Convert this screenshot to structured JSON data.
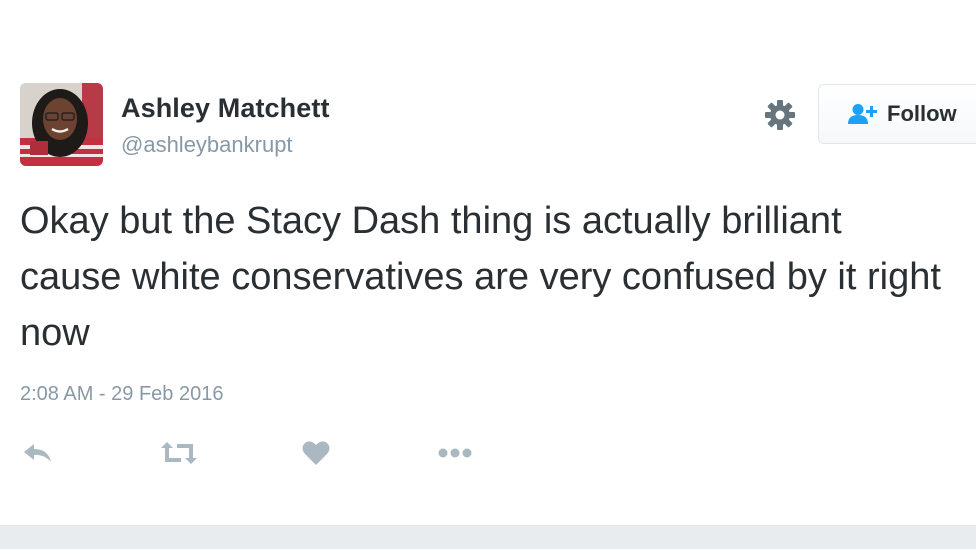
{
  "user": {
    "display_name": "Ashley Matchett",
    "screen_name": "@ashleybankrupt"
  },
  "follow_button": {
    "label": "Follow"
  },
  "tweet": {
    "text": "Okay but the Stacy Dash thing is actually brilliant cause white conservatives are very confused by it right now",
    "timestamp": "2:08 AM - 29 Feb 2016"
  },
  "actions": {
    "icons": [
      "reply-icon",
      "retweet-icon",
      "like-icon",
      "more-icon"
    ]
  },
  "colors": {
    "text": "#292f33",
    "secondary": "#8899a6",
    "accent": "#1da1f2",
    "icon": "#aab8c2"
  }
}
